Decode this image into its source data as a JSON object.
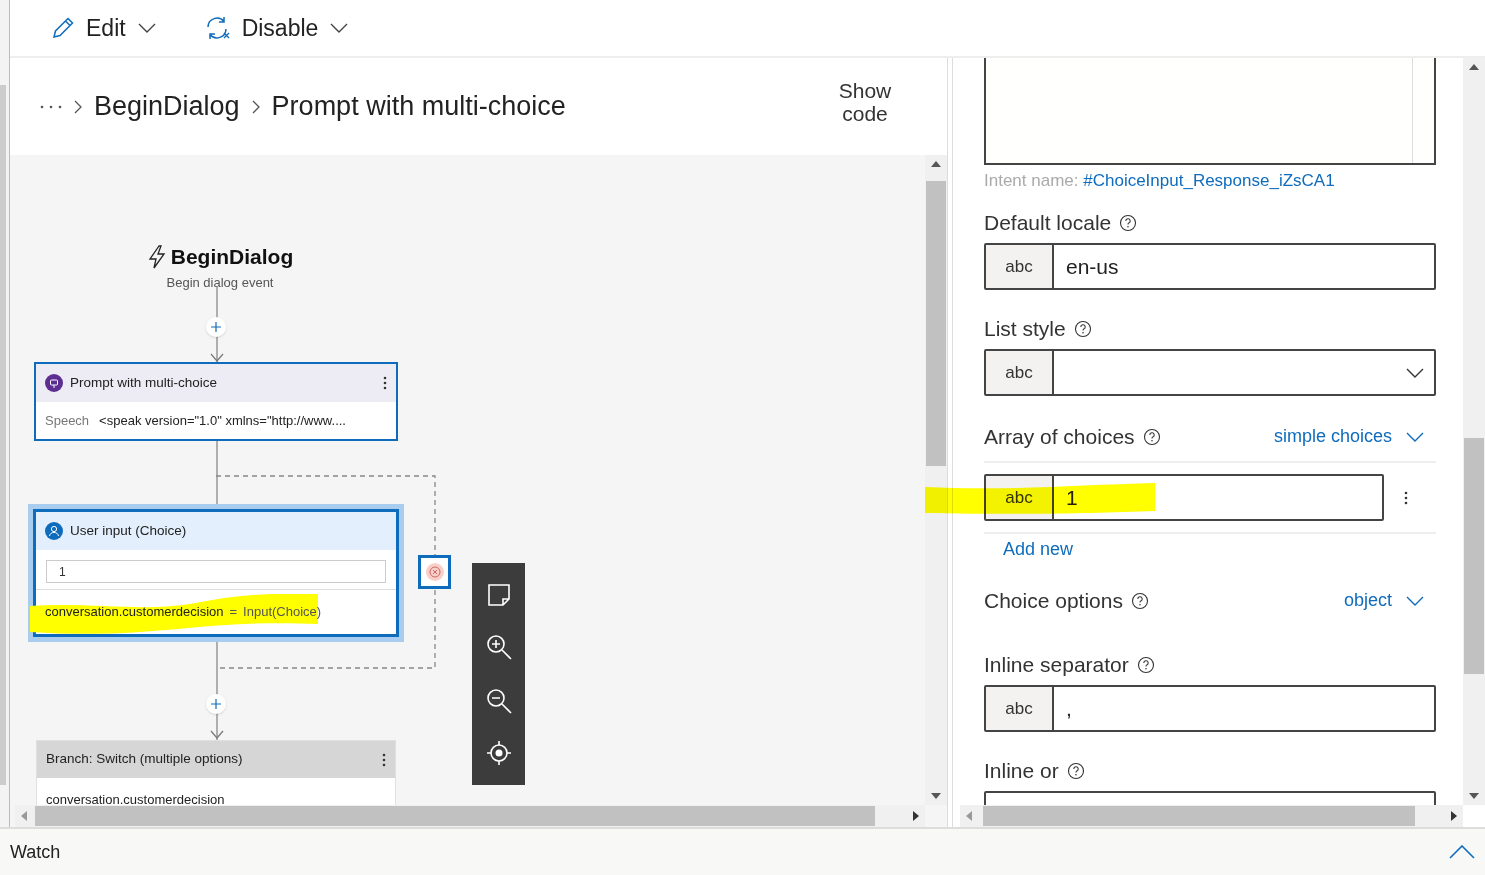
{
  "toolbar": [
    {
      "label": "Edit"
    },
    {
      "label": "Disable"
    }
  ],
  "breadcrumb": {
    "items": [
      "BeginDialog",
      "Prompt with multi-choice"
    ]
  },
  "show_code": "Show code",
  "canvas": {
    "trigger": {
      "title": "BeginDialog",
      "subtitle": "Begin dialog event"
    },
    "nodes": [
      {
        "kind": "prompt",
        "title": "Prompt with multi-choice",
        "label": "Speech",
        "value": "<speak version=\"1.0\" xmlns=\"http://www....",
        "selected": false
      },
      {
        "kind": "input",
        "title": "User input (Choice)",
        "field_value": "1",
        "assignment": "conversation.customerdecision",
        "operator": "=",
        "expression": "Input(Choice)",
        "selected": true
      },
      {
        "kind": "branch",
        "title": "Branch: Switch (multiple options)",
        "body": "conversation.customerdecision",
        "selected": false
      }
    ]
  },
  "properties": {
    "intent_label": "Intent name:",
    "intent_value": "#ChoiceInput_Response_iZsCA1",
    "fields": [
      {
        "kind": "text",
        "label": "Default locale",
        "type": "abc",
        "value": "en-us"
      },
      {
        "kind": "select",
        "label": "List style",
        "type": "abc"
      },
      {
        "kind": "array",
        "label": "Array of choices",
        "mode": "simple choices",
        "items": [
          {
            "type": "abc",
            "value": "1"
          }
        ],
        "add": "Add new"
      },
      {
        "kind": "object",
        "label": "Choice options",
        "mode": "object"
      },
      {
        "kind": "text",
        "label": "Inline separator",
        "type": "abc",
        "value": ","
      },
      {
        "kind": "text",
        "label": "Inline or"
      }
    ]
  },
  "watch": "Watch"
}
